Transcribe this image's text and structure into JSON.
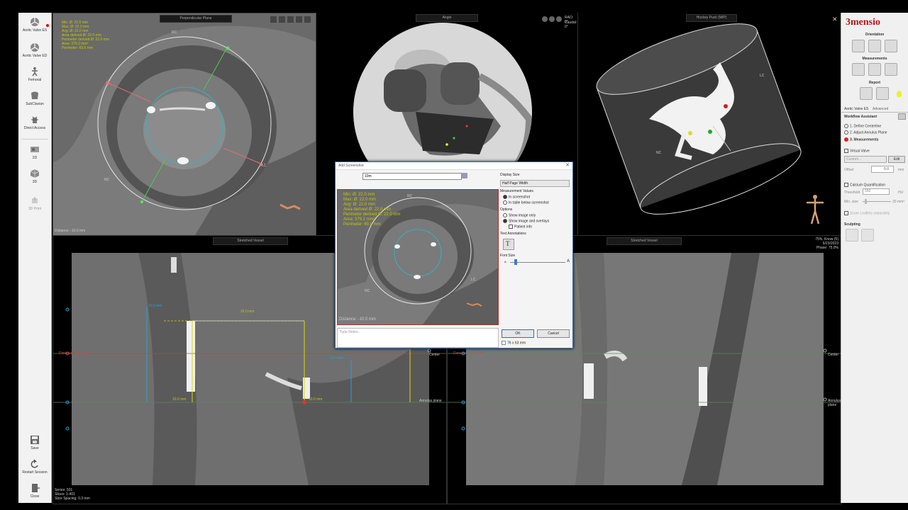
{
  "left_toolbar": {
    "items": [
      {
        "label": "Aortic Valve ES",
        "icon": "valve-icon"
      },
      {
        "label": "Aortic Valve ED",
        "icon": "valve-icon"
      },
      {
        "label": "Femoral",
        "icon": "body-figure-icon"
      },
      {
        "label": "SubClavian",
        "icon": "subclavian-icon"
      },
      {
        "label": "Direct Access",
        "icon": "direct-access-icon"
      },
      {
        "label": "2D",
        "icon": "2d-view-icon"
      },
      {
        "label": "3D",
        "icon": "3d-view-icon"
      },
      {
        "label": "3D Print",
        "icon": "3d-print-icon"
      },
      {
        "label": "Save",
        "icon": "save-icon"
      },
      {
        "label": "Restart Session",
        "icon": "restart-icon"
      },
      {
        "label": "Close",
        "icon": "close-door-icon"
      }
    ]
  },
  "viewports": {
    "tl": {
      "title": "Perpendicular Plane",
      "measurements": [
        "Min: Ø: 22.0 mm",
        "Max: Ø: 22.0 mm",
        "Avg: Ø: 22.0 mm",
        "Area derived Ø: 22.0 mm",
        "Perimeter derived Ø: 22.0 mm",
        "Area: 379.2 mm²",
        "Perimeter: 69.0 mm"
      ],
      "distance": "Distance: -10.0 mm",
      "labels": {
        "rc": "RC",
        "nc": "NC",
        "lc": "LC"
      }
    },
    "tc": {
      "title": "Angio",
      "rao": "RAO: 0°",
      "caudal": "Caudal: 0°"
    },
    "tr": {
      "title": "Hockey Puck (MIP)",
      "nc": "NC",
      "lc": "LC"
    },
    "bl": {
      "title": "Stretched Vessel",
      "distance_label": "Distance: -10.0 mm",
      "series": "Series: 501",
      "slices": "Slices: 1-401",
      "spacing": "Slice Spacing: 0.3 mm",
      "annulus_plane": "Annulus plane",
      "center": "Center",
      "dims": [
        "22.0 mm",
        "10.0 mm",
        "10.0 mm",
        "10.0 mm",
        "10.0 mm",
        "10.0 mm"
      ]
    },
    "br": {
      "title": "Stretched Vessel",
      "distance_label": "Distance: -10.0 mm",
      "info": [
        "75%, Know (5)",
        "6/23/2023",
        "Phase: 75.0%"
      ],
      "annulus_plane": "Annulus plane",
      "center": "Center"
    }
  },
  "right_panel": {
    "brand": "3mensio",
    "orientation": "Orientation",
    "measurements": "Measurements",
    "report": "Report",
    "tabs": [
      "Aortic Valve ES",
      "Advanced"
    ],
    "workflow_title": "Workflow Assistant",
    "steps": [
      "1. Define Centerline",
      "2. Adjust Annulus Plane",
      "3. Measurements"
    ],
    "virtual_valve": "Virtual Valve",
    "custom_placeholder": "Custom...",
    "edit": "Edit",
    "offset_label": "Offset",
    "offset_value": "0.0",
    "offset_unit": "mm",
    "calcium": "Calcium Quantification",
    "threshold_label": "Threshold",
    "threshold_value": "550",
    "threshold_unit": "HU",
    "min_size_label": "Min. size",
    "min_size_value": "20 mm³",
    "score_leaflets": "Score Leaflets separately",
    "sculpting": "Sculpting"
  },
  "dialog": {
    "title": "Add Screenshot",
    "name_value": "10m",
    "display_size_label": "Display Size",
    "display_size_value": "Half Page Width",
    "measurement_values": "Measurement Values",
    "opt_in_screenshot": "In screenshot",
    "opt_in_table": "In table below screenshot",
    "options": "Options",
    "opt_show_image": "Show image only",
    "opt_show_overlays": "Show image and overlays",
    "opt_patient_info": "Patient info",
    "text_annotations": "Text Annotations",
    "font_size": "Font Size",
    "font_small": "A",
    "font_large": "A",
    "preview_meas": [
      "Min: Ø: 22.0 mm",
      "Max: Ø: 22.0 mm",
      "Avg: Ø: 22.0 mm",
      "Area derived Ø: 22.0 mm",
      "Perimeter derived Ø: 22.0 mm",
      "Area: 379.2 mm²",
      "Perimeter: 69.0 mm"
    ],
    "preview_distance": "Distance: -10.0 mm",
    "preview_rc": "RC",
    "preview_nc": "NC",
    "preview_lc": "LC",
    "notes_placeholder": "Type Notes...",
    "ok": "OK",
    "cancel": "Cancel",
    "size_info": "76 x 63 mm",
    "font_slider_level": 0.08
  }
}
